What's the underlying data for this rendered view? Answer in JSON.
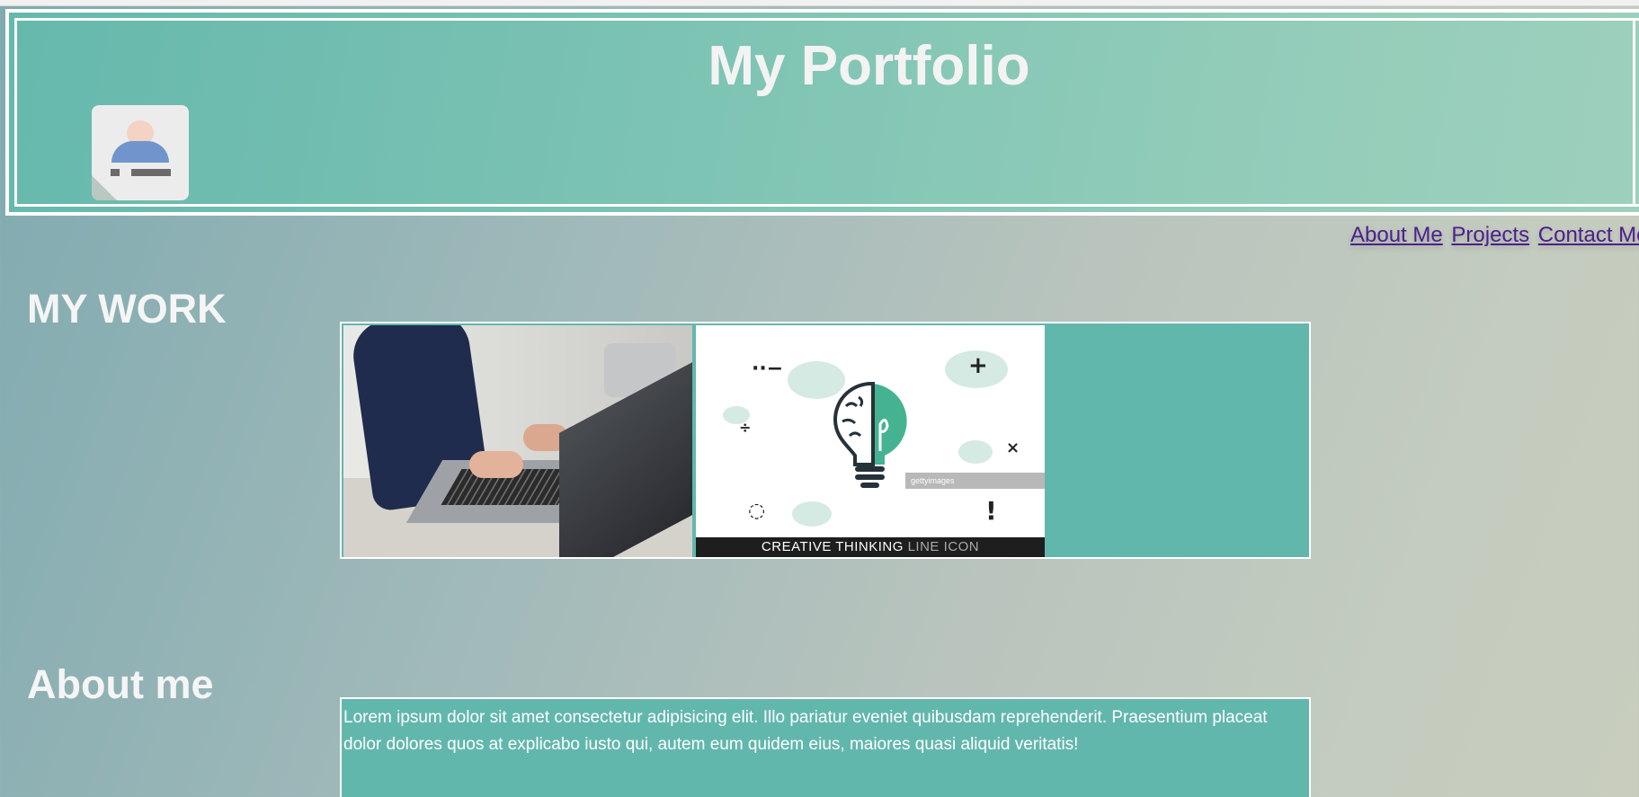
{
  "header": {
    "title": "My Portfolio",
    "avatar_icon": "person-card-icon"
  },
  "nav": {
    "links": [
      "About Me",
      "Projects",
      "Contact Me"
    ]
  },
  "sections": {
    "work_heading": "MY WORK",
    "about_heading": "About me"
  },
  "work": {
    "image1_alt": "person typing on laptop",
    "image2_alt": "creative thinking line icon",
    "image2_caption_bold": "CREATIVE THINKING",
    "image2_caption_thin": "LINE ICON",
    "image2_watermark": "gettyimages"
  },
  "about": {
    "text": "Lorem ipsum dolor sit amet consectetur adipisicing elit. Illo pariatur eveniet quibusdam reprehenderit. Praesentium placeat dolor dolores quos at explicabo iusto qui, autem eum quidem eius, maiores quasi aliquid veritatis!"
  },
  "colors": {
    "header_teal": "#7cc3b3",
    "box_teal": "#62b7ad",
    "link_purple": "#4b1f8d",
    "heading_white": "#f5f5f5"
  }
}
